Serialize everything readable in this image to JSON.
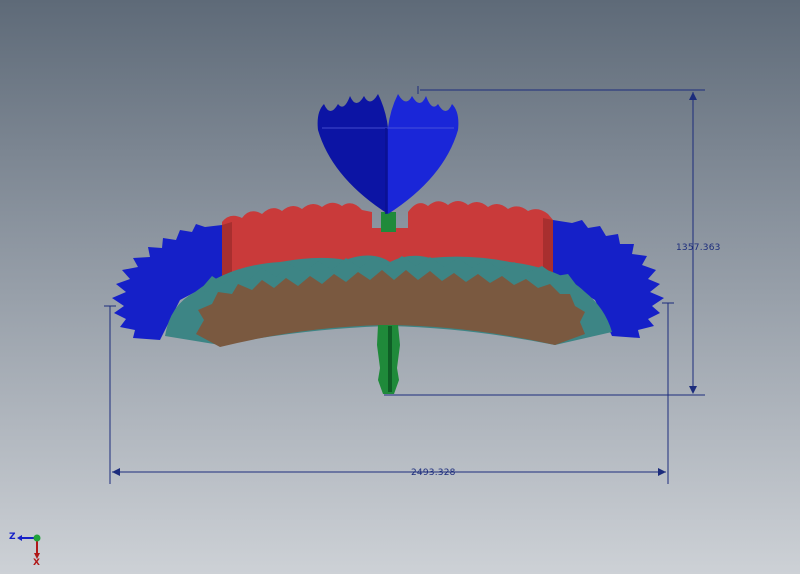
{
  "dimensions": {
    "height_value": "1357.363",
    "width_value": "2493.328"
  },
  "view_triad": {
    "z_label": "Z",
    "x_label": "X"
  },
  "colors": {
    "blue_feathers": "#1520c8",
    "red_body": "#c93a3a",
    "teal_band": "#3d8585",
    "brown_band": "#7a5940",
    "green_stem": "#1f8a3a",
    "dimension_line": "#1c2c7c"
  }
}
